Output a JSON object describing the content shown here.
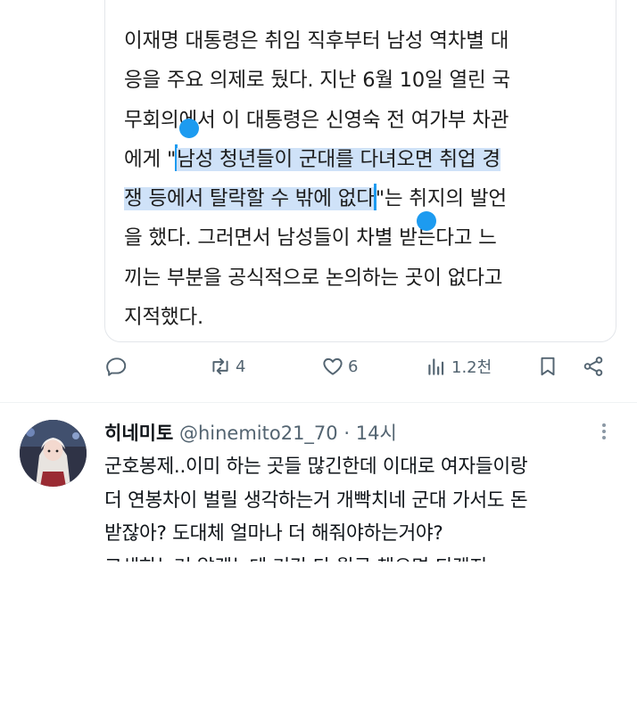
{
  "quote": {
    "lines": [
      "이재명 대통령은 취임 직후부터 남성 역차별 대",
      "응을 주요 의제로 뒀다. 지난 6월 10일 열린 국",
      "무회의에서 이 대통령은 신영숙 전 여가부 차관"
    ],
    "line4_pre": "에게 \"",
    "line4_sel": "남성 청년들이 군대를 다녀오면 취업 경",
    "line5_sel": "쟁 등에서 탈락할 수 밖에 없다",
    "line5_post": "\"는 취지의 발언",
    "lines_after": [
      "을 했다. 그러면서 남성들이 차별 받는다고 느",
      "끼는 부분을 공식적으로 논의하는 곳이 없다고",
      "지적했다."
    ]
  },
  "actions": {
    "reply_count": "",
    "retweet_count": "4",
    "like_count": "6",
    "views_count": "1.2천"
  },
  "reply": {
    "name": "히네미토",
    "handle": "@hinemito21_70",
    "separator": "·",
    "time": "14시",
    "lines": [
      "군호봉제..이미 하는 곳들 많긴한데 이대로 여자들이랑",
      "더 연봉차이 벌릴 생각하는거 개빡치네 군대 가서도 돈",
      "받잖아? 도대체 얼마나 더 해줘야하는거야?",
      "고생하는거 알겠는데 기간 다 월급 챙으면 되겠지"
    ]
  },
  "colors": {
    "selection": "#cfe2f8",
    "handle": "#1d9bf0",
    "icon": "#536471"
  }
}
